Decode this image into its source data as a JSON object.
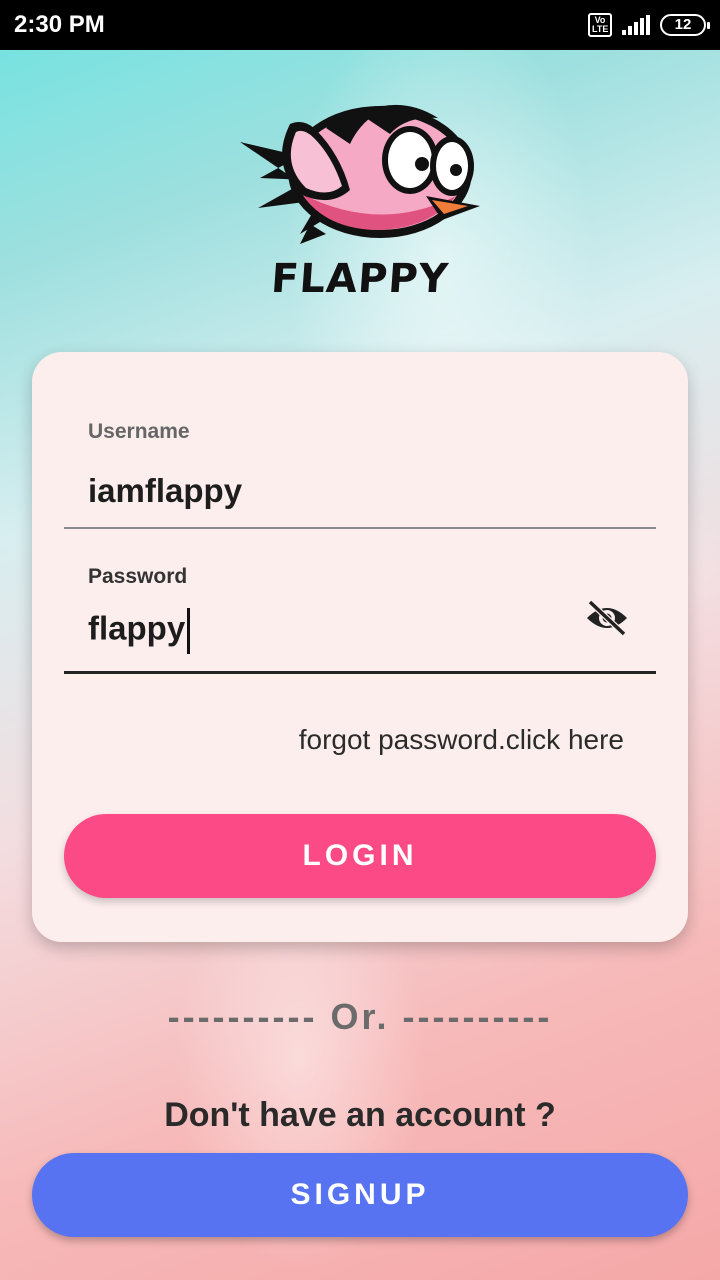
{
  "status_bar": {
    "time": "2:30 PM",
    "volte": "Vo LTE",
    "battery": "12"
  },
  "app": {
    "logo_text": "FLAPPY"
  },
  "login_form": {
    "username_label": "Username",
    "username_value": "iamflappy",
    "password_label": "Password",
    "password_value": "flappy",
    "forgot_text": "forgot password.click here",
    "login_label": "LOGIN"
  },
  "footer": {
    "divider_text": "----------   Or.   ----------",
    "no_account_text": "Don't have an account ?",
    "signup_label": "SIGNUP"
  },
  "colors": {
    "login_button": "#fb4a85",
    "signup_button": "#5773f1",
    "card": "#fdeeee"
  }
}
